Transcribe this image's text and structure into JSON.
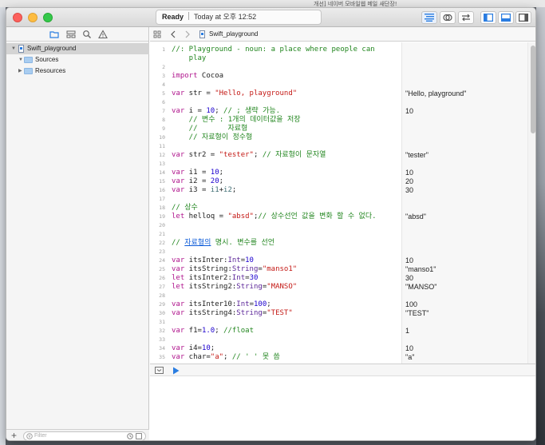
{
  "background": {
    "top_text": "개선] 네이버 모바일웹 메일 새단장!"
  },
  "window": {
    "status": {
      "state": "Ready",
      "time": "Today at 오후 12:52"
    }
  },
  "navigator": {
    "project": "Swift_playground",
    "items": [
      {
        "label": "Sources",
        "expanded": true
      },
      {
        "label": "Resources",
        "expanded": false
      }
    ],
    "filter_placeholder": "Filter"
  },
  "editor": {
    "jump_bar_file": "Swift_playground",
    "lines": [
      {
        "n": "1",
        "result": "",
        "tokens": [
          [
            "comment",
            "//: Playground - noun: a place where people can"
          ]
        ]
      },
      {
        "n": "",
        "result": "",
        "tokens": [
          [
            "comment",
            "    play"
          ]
        ]
      },
      {
        "n": "2",
        "result": "",
        "tokens": []
      },
      {
        "n": "3",
        "result": "",
        "tokens": [
          [
            "keyword",
            "import"
          ],
          [
            "plain",
            " Cocoa"
          ]
        ]
      },
      {
        "n": "4",
        "result": "",
        "tokens": []
      },
      {
        "n": "5",
        "result": "\"Hello, playground\"",
        "tokens": [
          [
            "keyword",
            "var"
          ],
          [
            "plain",
            " str = "
          ],
          [
            "string",
            "\"Hello, playground\""
          ]
        ]
      },
      {
        "n": "6",
        "result": "",
        "tokens": []
      },
      {
        "n": "7",
        "result": "10",
        "tokens": [
          [
            "keyword",
            "var"
          ],
          [
            "plain",
            " i = "
          ],
          [
            "number",
            "10"
          ],
          [
            "plain",
            "; "
          ],
          [
            "comment",
            "// ; 생략 가능."
          ]
        ]
      },
      {
        "n": "8",
        "result": "",
        "tokens": [
          [
            "comment",
            "    // 변수 : 1개의 데이터값을 저장"
          ]
        ]
      },
      {
        "n": "9",
        "result": "",
        "tokens": [
          [
            "comment",
            "    //       자료형"
          ]
        ]
      },
      {
        "n": "10",
        "result": "",
        "tokens": [
          [
            "comment",
            "    // 자료형이 정수형"
          ]
        ]
      },
      {
        "n": "11",
        "result": "",
        "tokens": []
      },
      {
        "n": "12",
        "result": "\"tester\"",
        "tokens": [
          [
            "keyword",
            "var"
          ],
          [
            "plain",
            " str2 = "
          ],
          [
            "string",
            "\"tester\""
          ],
          [
            "plain",
            "; "
          ],
          [
            "comment",
            "// 자료형이 문자열"
          ]
        ]
      },
      {
        "n": "13",
        "result": "",
        "tokens": []
      },
      {
        "n": "14",
        "result": "10",
        "tokens": [
          [
            "keyword",
            "var"
          ],
          [
            "plain",
            " i1 = "
          ],
          [
            "number",
            "10"
          ],
          [
            "plain",
            ";"
          ]
        ]
      },
      {
        "n": "15",
        "result": "20",
        "tokens": [
          [
            "keyword",
            "var"
          ],
          [
            "plain",
            " i2 = "
          ],
          [
            "number",
            "20"
          ],
          [
            "plain",
            ";"
          ]
        ]
      },
      {
        "n": "16",
        "result": "30",
        "tokens": [
          [
            "keyword",
            "var"
          ],
          [
            "plain",
            " i3 = "
          ],
          [
            "ident",
            "i1"
          ],
          [
            "plain",
            "+"
          ],
          [
            "ident",
            "i2"
          ],
          [
            "plain",
            ";"
          ]
        ]
      },
      {
        "n": "17",
        "result": "",
        "tokens": []
      },
      {
        "n": "18",
        "result": "",
        "tokens": [
          [
            "comment",
            "// 상수"
          ]
        ]
      },
      {
        "n": "19",
        "result": "\"absd\"",
        "tokens": [
          [
            "keyword",
            "let"
          ],
          [
            "plain",
            " helloq = "
          ],
          [
            "string",
            "\"absd\""
          ],
          [
            "plain",
            ";"
          ],
          [
            "comment",
            "// 상수선언 값을 변화 할 수 없다."
          ]
        ]
      },
      {
        "n": "20",
        "result": "",
        "tokens": []
      },
      {
        "n": "21",
        "result": "",
        "tokens": []
      },
      {
        "n": "22",
        "result": "",
        "tokens": [
          [
            "comment",
            "// "
          ],
          [
            "link",
            "자료형의"
          ],
          [
            "comment",
            " 명시. 변수를 선언"
          ]
        ]
      },
      {
        "n": "23",
        "result": "",
        "tokens": []
      },
      {
        "n": "24",
        "result": "10",
        "tokens": [
          [
            "keyword",
            "var"
          ],
          [
            "plain",
            " itsInter:"
          ],
          [
            "type",
            "Int"
          ],
          [
            "plain",
            "="
          ],
          [
            "number",
            "10"
          ]
        ]
      },
      {
        "n": "25",
        "result": "\"manso1\"",
        "tokens": [
          [
            "keyword",
            "var"
          ],
          [
            "plain",
            " itsString:"
          ],
          [
            "type",
            "String"
          ],
          [
            "plain",
            "="
          ],
          [
            "string",
            "\"manso1\""
          ]
        ]
      },
      {
        "n": "26",
        "result": "30",
        "tokens": [
          [
            "keyword",
            "let"
          ],
          [
            "plain",
            " itsInter2:"
          ],
          [
            "type",
            "Int"
          ],
          [
            "plain",
            "="
          ],
          [
            "number",
            "30"
          ]
        ]
      },
      {
        "n": "27",
        "result": "\"MANSO\"",
        "tokens": [
          [
            "keyword",
            "let"
          ],
          [
            "plain",
            " itsString2:"
          ],
          [
            "type",
            "String"
          ],
          [
            "plain",
            "="
          ],
          [
            "string",
            "\"MANSO\""
          ]
        ]
      },
      {
        "n": "28",
        "result": "",
        "tokens": []
      },
      {
        "n": "29",
        "result": "100",
        "tokens": [
          [
            "keyword",
            "var"
          ],
          [
            "plain",
            " itsInter10:"
          ],
          [
            "type",
            "Int"
          ],
          [
            "plain",
            "="
          ],
          [
            "number",
            "100"
          ],
          [
            "plain",
            ";"
          ]
        ]
      },
      {
        "n": "30",
        "result": "\"TEST\"",
        "tokens": [
          [
            "keyword",
            "var"
          ],
          [
            "plain",
            " itsString4:"
          ],
          [
            "type",
            "String"
          ],
          [
            "plain",
            "="
          ],
          [
            "string",
            "\"TEST\""
          ]
        ]
      },
      {
        "n": "31",
        "result": "",
        "tokens": []
      },
      {
        "n": "32",
        "result": "1",
        "tokens": [
          [
            "keyword",
            "var"
          ],
          [
            "plain",
            " f1="
          ],
          [
            "number",
            "1.0"
          ],
          [
            "plain",
            "; "
          ],
          [
            "comment",
            "//float"
          ]
        ]
      },
      {
        "n": "33",
        "result": "",
        "tokens": []
      },
      {
        "n": "34",
        "result": "10",
        "tokens": [
          [
            "keyword",
            "var"
          ],
          [
            "plain",
            " i4="
          ],
          [
            "number",
            "10"
          ],
          [
            "plain",
            ";"
          ]
        ]
      },
      {
        "n": "35",
        "result": "\"a\"",
        "tokens": [
          [
            "keyword",
            "var"
          ],
          [
            "plain",
            " char="
          ],
          [
            "string",
            "\"a\""
          ],
          [
            "plain",
            "; "
          ],
          [
            "comment",
            "// ' ' 못 씀"
          ]
        ]
      }
    ]
  },
  "colors": {
    "comment": "#22861f",
    "keyword": "#b0168d",
    "string": "#c41a16",
    "number": "#1c00cf",
    "accent": "#2a7de1"
  }
}
